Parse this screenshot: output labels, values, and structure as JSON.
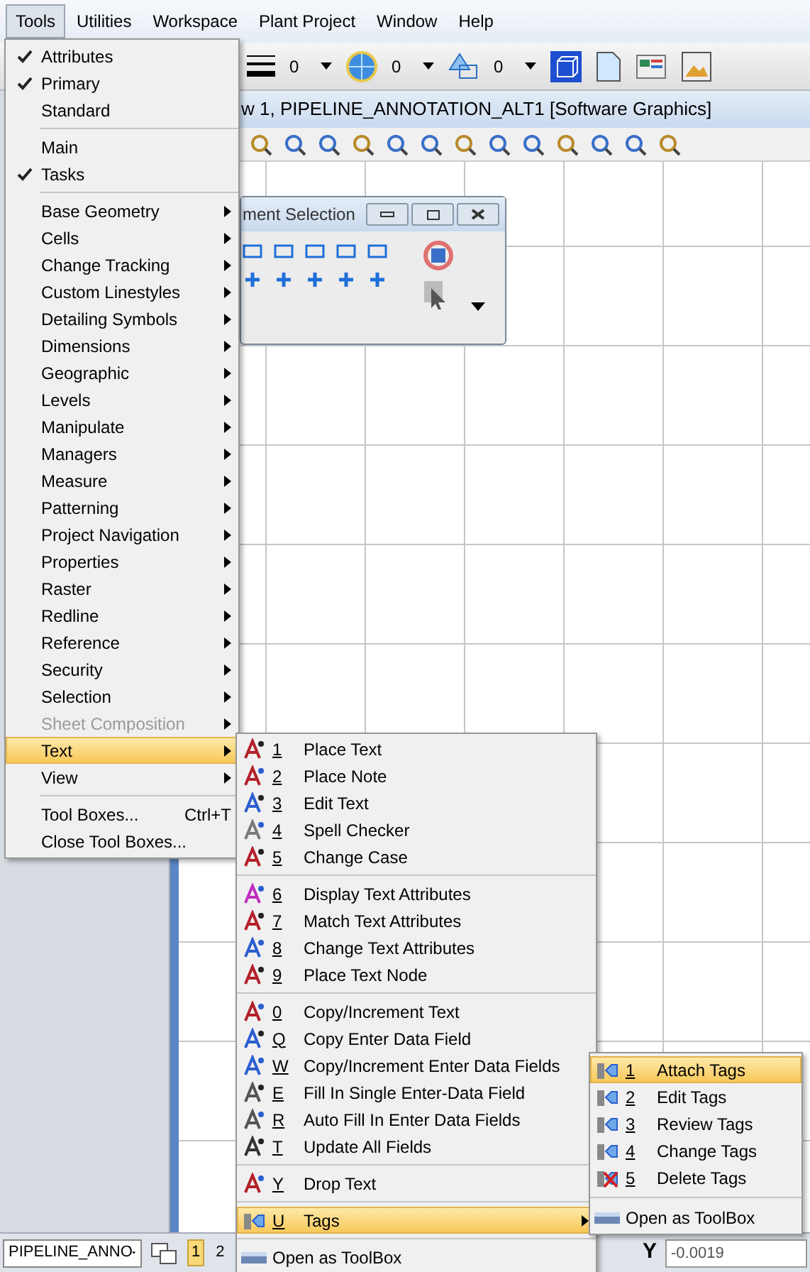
{
  "menubar": [
    {
      "label": "Tools",
      "selected": true
    },
    {
      "label": "Utilities",
      "selected": false
    },
    {
      "label": "Workspace",
      "selected": false
    },
    {
      "label": "Plant Project",
      "selected": false
    },
    {
      "label": "Window",
      "selected": false
    },
    {
      "label": "Help",
      "selected": false
    }
  ],
  "toolbar": {
    "weight_value": "0",
    "level_value": "0",
    "class_value": "0"
  },
  "view": {
    "title": "w 1, PIPELINE_ANNOTATION_ALT1 [Software Graphics]"
  },
  "element_selection": {
    "title": "ment Selection"
  },
  "tools_menu": [
    [
      {
        "label": "Attributes",
        "kind": "check",
        "checked": true
      },
      {
        "label": "Primary",
        "kind": "check",
        "checked": true
      },
      {
        "label": "Standard",
        "kind": "check",
        "checked": false
      }
    ],
    [
      {
        "label": "Main",
        "kind": "check",
        "checked": false
      },
      {
        "label": "Tasks",
        "kind": "check",
        "checked": true
      }
    ],
    [
      {
        "label": "Base Geometry",
        "kind": "submenu",
        "disabled": false,
        "selected": false
      },
      {
        "label": "Cells",
        "kind": "submenu",
        "disabled": false,
        "selected": false
      },
      {
        "label": "Change Tracking",
        "kind": "submenu",
        "disabled": false,
        "selected": false
      },
      {
        "label": "Custom Linestyles",
        "kind": "submenu",
        "disabled": false,
        "selected": false
      },
      {
        "label": "Detailing Symbols",
        "kind": "submenu",
        "disabled": false,
        "selected": false
      },
      {
        "label": "Dimensions",
        "kind": "submenu",
        "disabled": false,
        "selected": false
      },
      {
        "label": "Geographic",
        "kind": "submenu",
        "disabled": false,
        "selected": false
      },
      {
        "label": "Levels",
        "kind": "submenu",
        "disabled": false,
        "selected": false
      },
      {
        "label": "Manipulate",
        "kind": "submenu",
        "disabled": false,
        "selected": false
      },
      {
        "label": "Managers",
        "kind": "submenu",
        "disabled": false,
        "selected": false
      },
      {
        "label": "Measure",
        "kind": "submenu",
        "disabled": false,
        "selected": false
      },
      {
        "label": "Patterning",
        "kind": "submenu",
        "disabled": false,
        "selected": false
      },
      {
        "label": "Project Navigation",
        "kind": "submenu",
        "disabled": false,
        "selected": false
      },
      {
        "label": "Properties",
        "kind": "submenu",
        "disabled": false,
        "selected": false
      },
      {
        "label": "Raster",
        "kind": "submenu",
        "disabled": false,
        "selected": false
      },
      {
        "label": "Redline",
        "kind": "submenu",
        "disabled": false,
        "selected": false
      },
      {
        "label": "Reference",
        "kind": "submenu",
        "disabled": false,
        "selected": false
      },
      {
        "label": "Security",
        "kind": "submenu",
        "disabled": false,
        "selected": false
      },
      {
        "label": "Selection",
        "kind": "submenu",
        "disabled": false,
        "selected": false
      },
      {
        "label": "Sheet Composition",
        "kind": "submenu",
        "disabled": true,
        "selected": false
      },
      {
        "label": "Text",
        "kind": "submenu",
        "disabled": false,
        "selected": true
      },
      {
        "label": "View",
        "kind": "submenu",
        "disabled": false,
        "selected": false
      }
    ],
    [
      {
        "label": "Tool Boxes...",
        "kind": "command",
        "shortcut": "Ctrl+T"
      },
      {
        "label": "Close Tool Boxes...",
        "kind": "command"
      }
    ]
  ],
  "text_submenu": [
    [
      {
        "key": "1",
        "label": "Place Text",
        "kind": "command"
      },
      {
        "key": "2",
        "label": "Place Note",
        "kind": "command"
      },
      {
        "key": "3",
        "label": "Edit Text",
        "kind": "command"
      },
      {
        "key": "4",
        "label": "Spell Checker",
        "kind": "command"
      },
      {
        "key": "5",
        "label": "Change Case",
        "kind": "command"
      }
    ],
    [
      {
        "key": "6",
        "label": "Display Text Attributes",
        "kind": "command"
      },
      {
        "key": "7",
        "label": "Match Text Attributes",
        "kind": "command"
      },
      {
        "key": "8",
        "label": "Change Text Attributes",
        "kind": "command"
      },
      {
        "key": "9",
        "label": "Place Text Node",
        "kind": "command"
      }
    ],
    [
      {
        "key": "0",
        "label": "Copy/Increment Text",
        "kind": "command"
      },
      {
        "key": "Q",
        "label": "Copy Enter Data Field",
        "kind": "command"
      },
      {
        "key": "W",
        "label": "Copy/Increment Enter Data Fields",
        "kind": "command"
      },
      {
        "key": "E",
        "label": "Fill In Single Enter-Data Field",
        "kind": "command"
      },
      {
        "key": "R",
        "label": "Auto Fill In Enter Data Fields",
        "kind": "command"
      },
      {
        "key": "T",
        "label": "Update All Fields",
        "kind": "command"
      }
    ],
    [
      {
        "key": "Y",
        "label": "Drop Text",
        "kind": "command"
      }
    ],
    [
      {
        "key": "U",
        "label": "Tags",
        "kind": "submenu",
        "selected": true
      }
    ],
    [
      {
        "label": "Open as ToolBox",
        "kind": "toolbox"
      }
    ]
  ],
  "tags_submenu": [
    [
      {
        "key": "1",
        "label": "Attach Tags",
        "selected": true
      },
      {
        "key": "2",
        "label": "Edit Tags",
        "selected": false
      },
      {
        "key": "3",
        "label": "Review Tags",
        "selected": false
      },
      {
        "key": "4",
        "label": "Change Tags",
        "selected": false
      },
      {
        "key": "5",
        "label": "Delete Tags",
        "selected": false
      }
    ],
    [
      {
        "label": "Open as ToolBox",
        "selected": false
      }
    ]
  ],
  "status_bar": {
    "model": "PIPELINE_ANNO",
    "views": [
      "1",
      "2"
    ],
    "y_label": "Y",
    "y_value": "-0.0019"
  }
}
